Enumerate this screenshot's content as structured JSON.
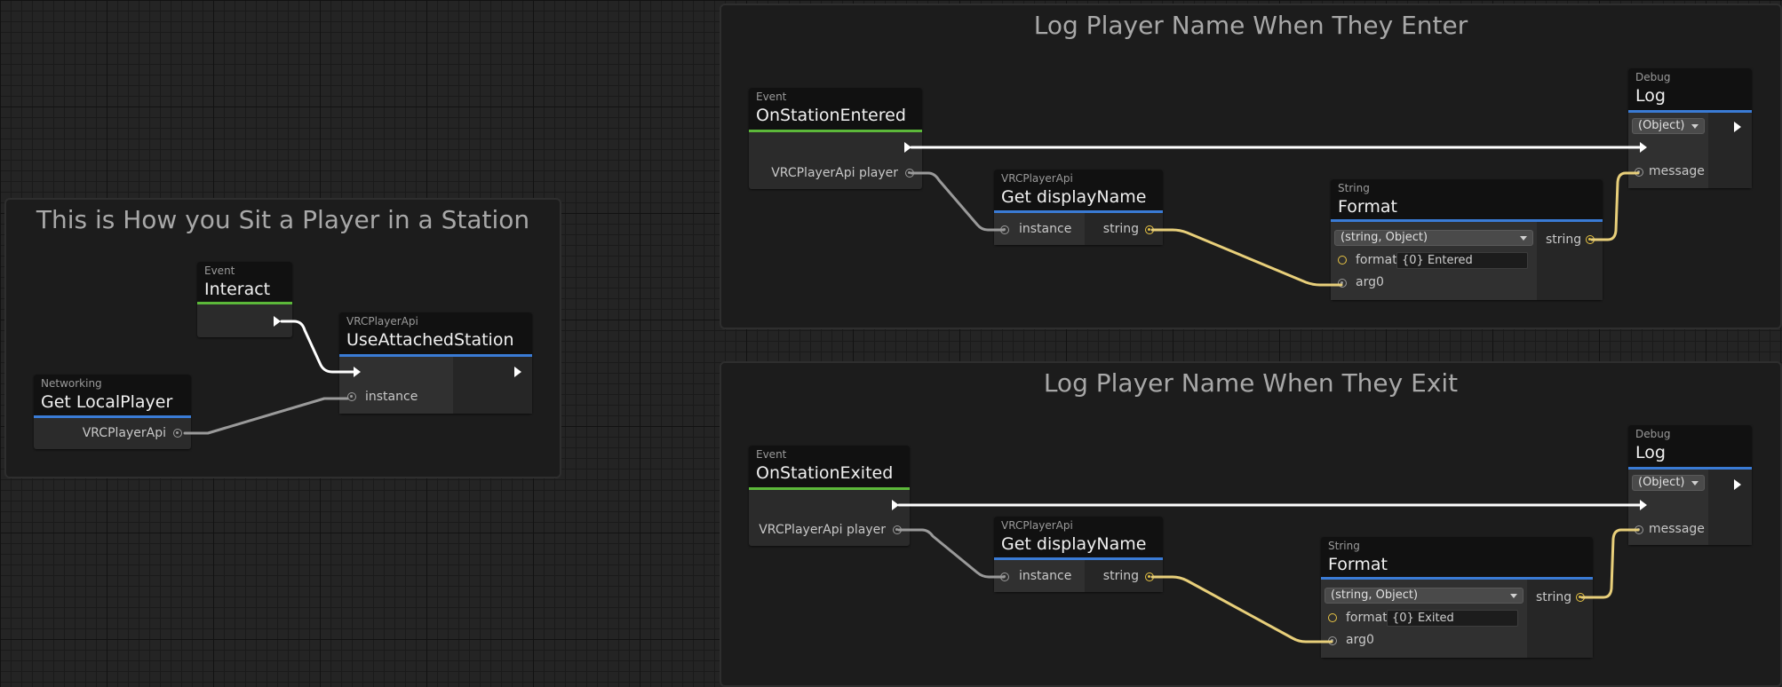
{
  "groups": {
    "sit": {
      "title": "This is How you Sit a Player in a Station"
    },
    "enter": {
      "title": "Log Player Name When They Enter"
    },
    "exit": {
      "title": "Log Player Name When They Exit"
    }
  },
  "nodes": {
    "interact": {
      "category": "Event",
      "title": "Interact"
    },
    "get_local_player": {
      "category": "Networking",
      "title": "Get LocalPlayer",
      "out_label": "VRCPlayerApi"
    },
    "use_attached_station": {
      "category": "VRCPlayerApi",
      "title": "UseAttachedStation",
      "in_label": "instance"
    },
    "on_station_entered": {
      "category": "Event",
      "title": "OnStationEntered",
      "out_label": "VRCPlayerApi player"
    },
    "get_display_name_enter": {
      "category": "VRCPlayerApi",
      "title": "Get displayName",
      "in_label": "instance",
      "out_label": "string"
    },
    "format_enter": {
      "category": "String",
      "title": "Format",
      "overload": "(string, Object)",
      "format_label": "format",
      "format_value": "{0} Entered",
      "arg_label": "arg0",
      "out_label": "string"
    },
    "log_enter": {
      "category": "Debug",
      "title": "Log",
      "overload": "(Object)",
      "in_label": "message"
    },
    "on_station_exited": {
      "category": "Event",
      "title": "OnStationExited",
      "out_label": "VRCPlayerApi player"
    },
    "get_display_name_exit": {
      "category": "VRCPlayerApi",
      "title": "Get displayName",
      "in_label": "instance",
      "out_label": "string"
    },
    "format_exit": {
      "category": "String",
      "title": "Format",
      "overload": "(string, Object)",
      "format_label": "format",
      "format_value": "{0} Exited",
      "arg_label": "arg0",
      "out_label": "string"
    },
    "log_exit": {
      "category": "Debug",
      "title": "Log",
      "overload": "(Object)",
      "in_label": "message"
    }
  },
  "colors": {
    "event_accent": "#5cb83a",
    "method_accent": "#3a7bd5",
    "string_wire": "#e8cf7a",
    "object_wire": "#9a9a9a",
    "exec_wire": "#ffffff"
  },
  "icons": {
    "exec_port": "exec-arrow-icon",
    "value_port": "port-dot-icon"
  }
}
